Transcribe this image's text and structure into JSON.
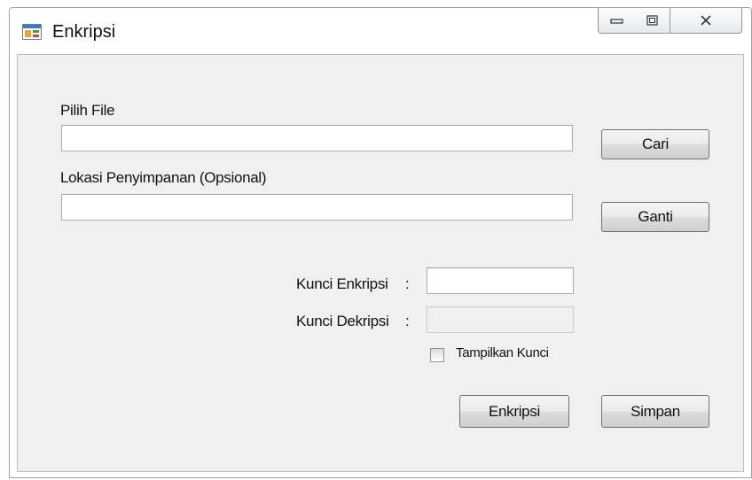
{
  "window": {
    "title": "Enkripsi",
    "icon": "form-icon",
    "controls": {
      "minimize": "minimize-icon",
      "maximize": "maximize-icon",
      "close": "close-icon"
    }
  },
  "form": {
    "file_label": "Pilih File",
    "file_value": "",
    "browse_button": "Cari",
    "save_location_label": "Lokasi Penyimpanan (Opsional)",
    "save_location_value": "",
    "change_button": "Ganti",
    "encrypt_key_label": "Kunci Enkripsi",
    "encrypt_key_value": "",
    "decrypt_key_label": "Kunci Dekripsi",
    "decrypt_key_value": "",
    "colon": ":",
    "show_key_label": "Tampilkan Kunci",
    "show_key_checked": false,
    "encrypt_button": "Enkripsi",
    "save_button": "Simpan"
  }
}
